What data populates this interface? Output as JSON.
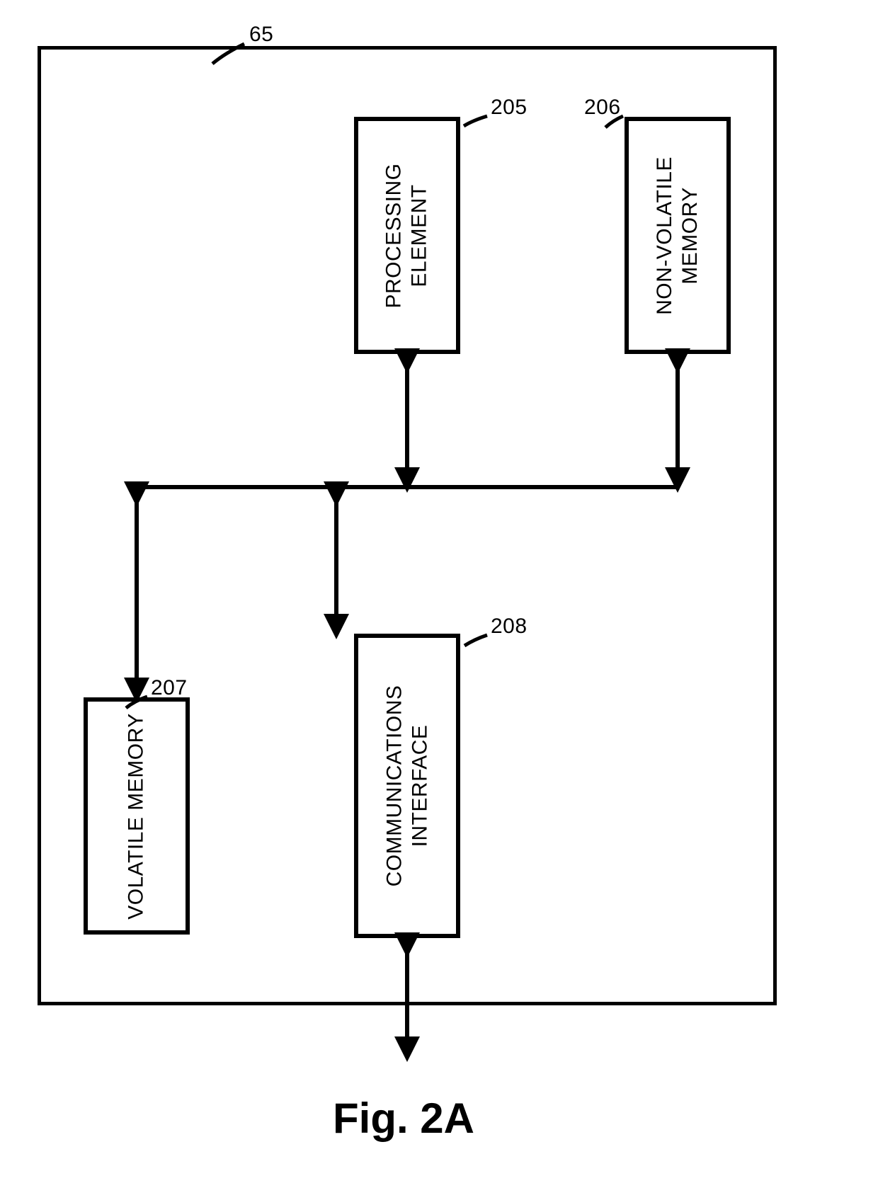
{
  "figure_label": "Fig. 2A",
  "container_ref": "65",
  "blocks": {
    "processing": {
      "label_line1": "PROCESSING",
      "label_line2": "ELEMENT",
      "ref": "205"
    },
    "nonvolatile": {
      "label_line1": "NON-VOLATILE",
      "label_line2": "MEMORY",
      "ref": "206"
    },
    "volatile": {
      "label": "VOLATILE MEMORY",
      "ref": "207"
    },
    "comm": {
      "label_line1": "COMMUNICATIONS",
      "label_line2": "INTERFACE",
      "ref": "208"
    }
  }
}
